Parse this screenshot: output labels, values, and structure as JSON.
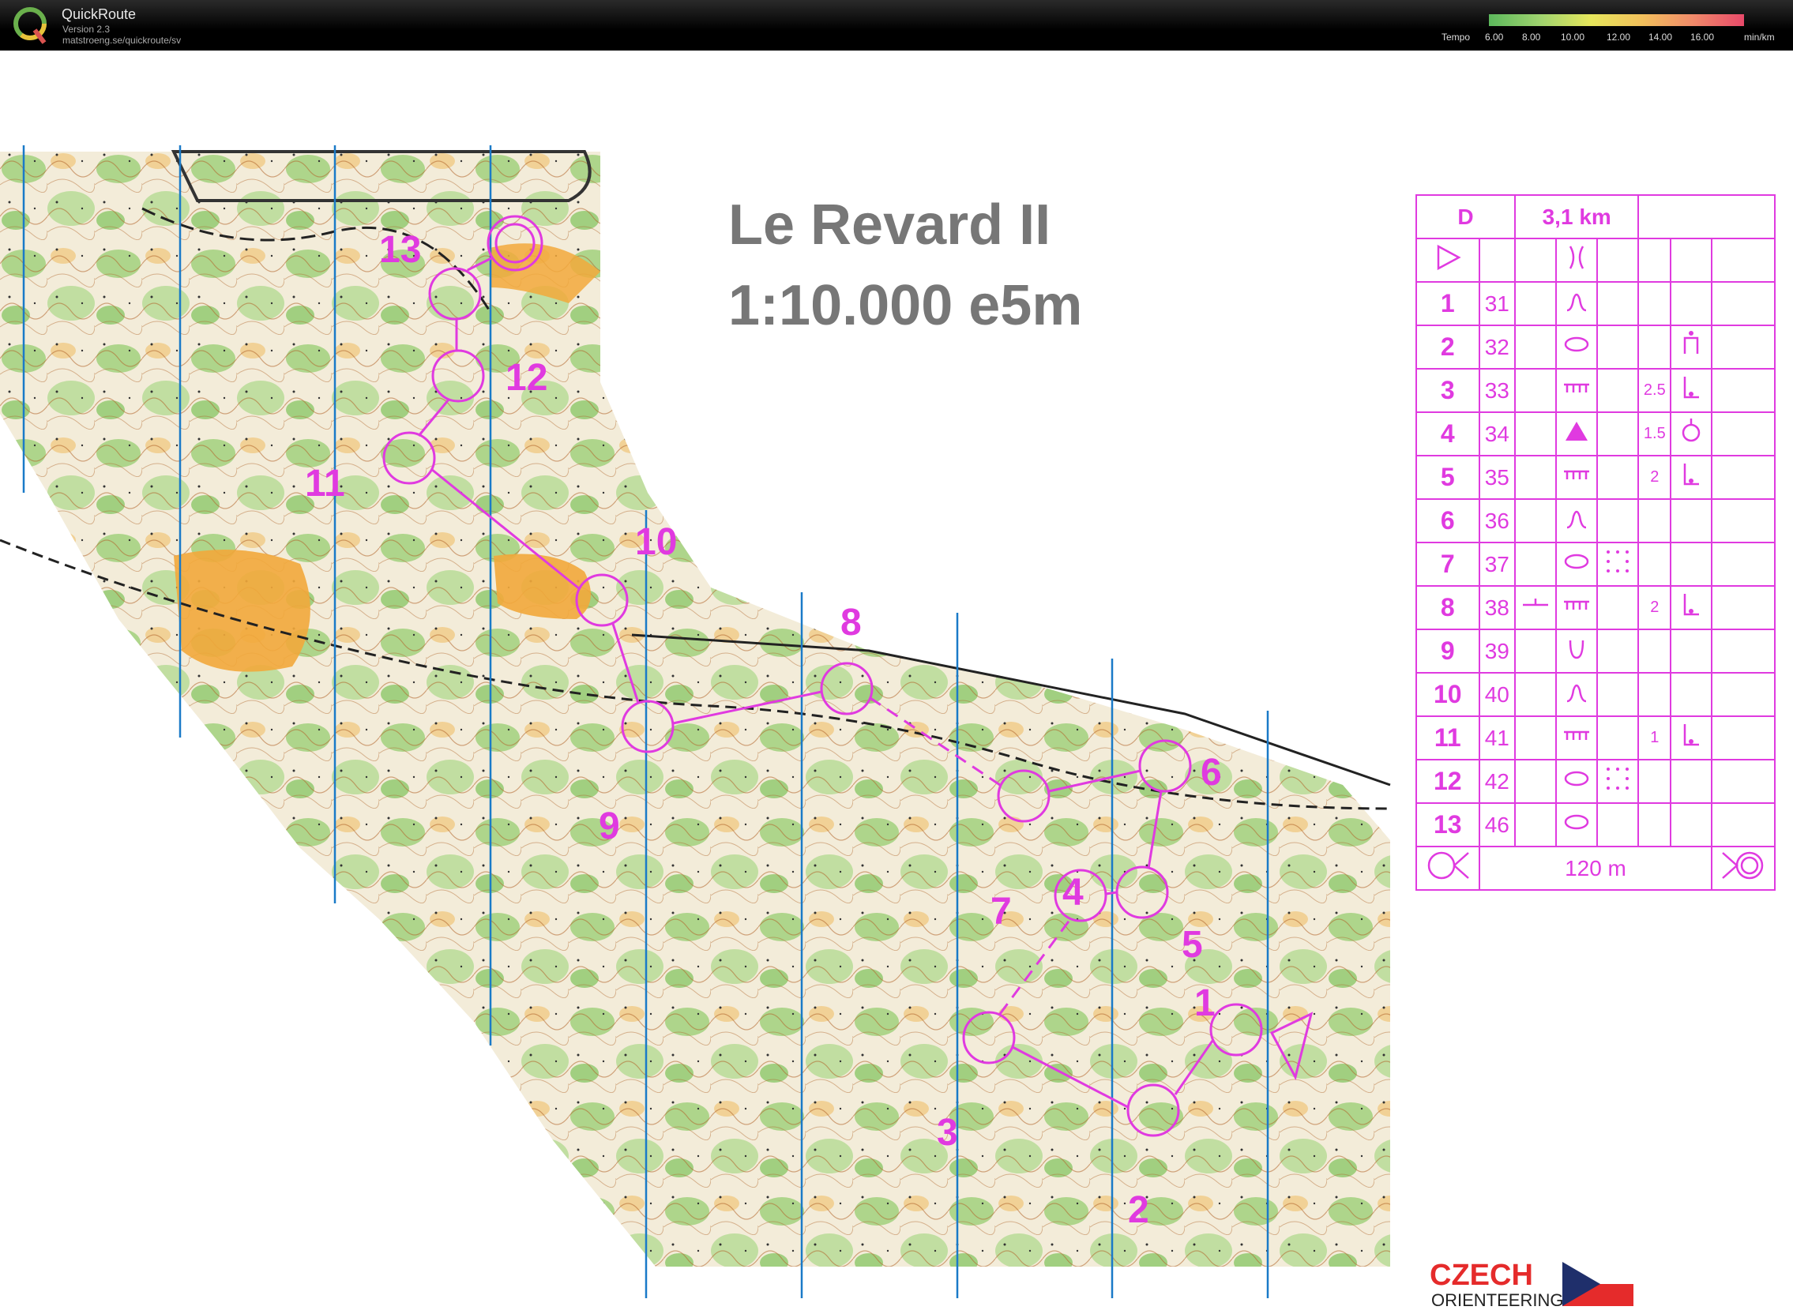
{
  "app": {
    "name": "QuickRoute",
    "version": "Version 2.3",
    "url": "matstroeng.se/quickroute/sv"
  },
  "pace_legend": {
    "label": "Tempo",
    "ticks": [
      "6.00",
      "8.00",
      "10.00",
      "12.00",
      "14.00",
      "16.00"
    ],
    "unit": "min/km",
    "colors": [
      "#5cb85c",
      "#9fd36f",
      "#e6e65c",
      "#f2c05c",
      "#f08a6a",
      "#e84a6a"
    ]
  },
  "map": {
    "title_line1": "Le Revard II",
    "title_line2": "1:10.000  e5m",
    "control_labels": [
      "1",
      "2",
      "3",
      "4",
      "5",
      "6",
      "7",
      "8",
      "9",
      "10",
      "11",
      "12",
      "13"
    ],
    "course_color": "#e03ae0",
    "north_line_color": "#1a7ac8"
  },
  "description": {
    "header": {
      "class": "D",
      "length": "3,1 km"
    },
    "rows": [
      {
        "num": "1",
        "code": "31",
        "feature": "knoll-profile",
        "dim": "",
        "loc": ""
      },
      {
        "num": "2",
        "code": "32",
        "feature": "depression-oval",
        "dim": "",
        "loc": "top-foot"
      },
      {
        "num": "3",
        "code": "33",
        "feature": "cliff",
        "dim": "2.5",
        "loc": "foot"
      },
      {
        "num": "4",
        "code": "34",
        "feature": "triangle",
        "dim": "1.5",
        "loc": "circle-stand"
      },
      {
        "num": "5",
        "code": "35",
        "feature": "cliff",
        "dim": "2",
        "loc": "foot"
      },
      {
        "num": "6",
        "code": "36",
        "feature": "knoll-profile",
        "dim": "",
        "loc": ""
      },
      {
        "num": "7",
        "code": "37",
        "feature": "depression-oval",
        "extra": "dots",
        "dim": "",
        "loc": ""
      },
      {
        "num": "8",
        "code": "38",
        "feature": "cliff",
        "pre": "line-mark",
        "dim": "2",
        "loc": "foot"
      },
      {
        "num": "9",
        "code": "39",
        "feature": "cup",
        "dim": "",
        "loc": ""
      },
      {
        "num": "10",
        "code": "40",
        "feature": "knoll-profile",
        "dim": "",
        "loc": ""
      },
      {
        "num": "11",
        "code": "41",
        "feature": "cliff",
        "dim": "1",
        "loc": "foot"
      },
      {
        "num": "12",
        "code": "42",
        "feature": "depression-oval",
        "extra": "dots",
        "dim": "",
        "loc": ""
      },
      {
        "num": "13",
        "code": "46",
        "feature": "depression-oval",
        "dim": "",
        "loc": ""
      }
    ],
    "footer": "120 m"
  },
  "logo": {
    "top": "CZECH",
    "bottom": "ORIENTEERING"
  }
}
